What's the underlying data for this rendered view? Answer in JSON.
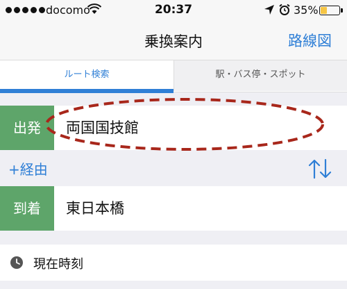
{
  "status_bar": {
    "carrier": "docomo",
    "time": "20:37",
    "battery_percent_text": "35%",
    "battery_level": 0.35,
    "battery_color": "#f6c544"
  },
  "nav": {
    "title": "乗換案内",
    "right_button": "路線図"
  },
  "tabs": [
    {
      "label": "ルート検索",
      "selected": true
    },
    {
      "label": "駅・バス停・スポット",
      "selected": false
    }
  ],
  "route": {
    "from_label": "出発",
    "from_value": "両国国技館",
    "via_label": "+経由",
    "to_label": "到着",
    "to_value": "東日本橋"
  },
  "time": {
    "label": "現在時刻"
  },
  "icons": {
    "wifi": "wifi-icon",
    "location": "location-arrow-icon",
    "alarm": "alarm-clock-icon",
    "swap": "swap-arrows-icon",
    "clock": "clock-icon"
  },
  "colors": {
    "accent": "#2f7fd6",
    "label_green": "#5ea56a",
    "annotation": "#a8271b"
  }
}
